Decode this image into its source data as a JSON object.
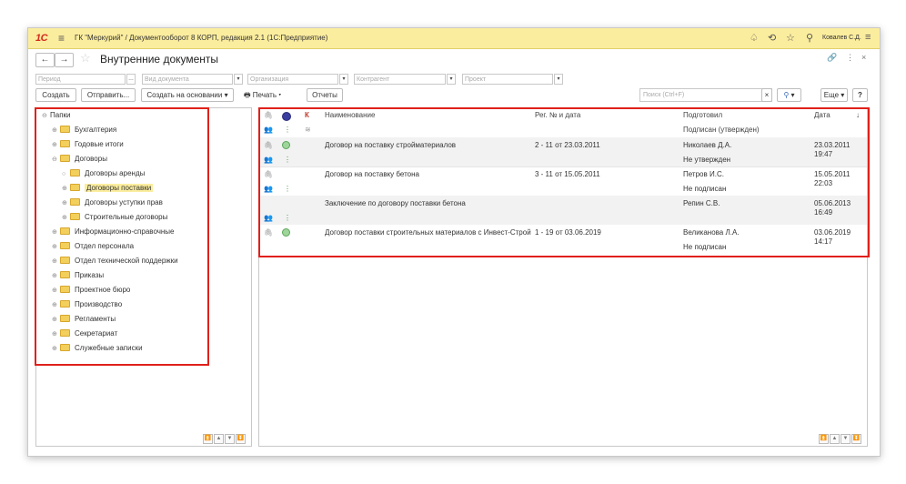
{
  "titlebar": {
    "logo": "1С",
    "menu_icon": "hamburger-icon",
    "title": "ГК \"Меркурий\" / Документооборот 8 КОРП, редакция 2.1  (1С:Предприятие)",
    "user": "Ковалев С.Д."
  },
  "page": {
    "title": "Внутренние документы"
  },
  "filters": {
    "period": "Период",
    "doc_type": "Вид документа",
    "organization": "Организация",
    "counterparty": "Контрагент",
    "project": "Проект"
  },
  "toolbar": {
    "create": "Создать",
    "send": "Отправить...",
    "create_based": "Создать на основании",
    "print": "Печать",
    "reports": "Отчеты",
    "search_placeholder": "Поиск (Ctrl+F)",
    "more": "Еще",
    "help": "?"
  },
  "tree": {
    "root": "Папки",
    "items": [
      {
        "label": "Бухгалтерия"
      },
      {
        "label": "Годовые итоги"
      },
      {
        "label": "Договоры"
      },
      {
        "label": "Договоры аренды"
      },
      {
        "label": "Договоры поставки"
      },
      {
        "label": "Договоры уступки прав"
      },
      {
        "label": "Строительные договоры"
      },
      {
        "label": "Информационно-справочные"
      },
      {
        "label": "Отдел персонала"
      },
      {
        "label": "Отдел технической поддержки"
      },
      {
        "label": "Приказы"
      },
      {
        "label": "Проектное бюро"
      },
      {
        "label": "Производство"
      },
      {
        "label": "Регламенты"
      },
      {
        "label": "Секретариат"
      },
      {
        "label": "Служебные записки"
      }
    ]
  },
  "table": {
    "headers": {
      "k": "К",
      "name": "Наименование",
      "reg": "Рег. № и дата",
      "prepared": "Подготовил",
      "signed": "Подписан (утвержден)",
      "date": "Дата",
      "sort": "↓"
    },
    "rows": [
      {
        "name": "Договор на поставку стройматериалов",
        "reg": "2 - 11 от 23.03.2011",
        "prepared": "Николаев Д.А.",
        "signed": "Не утвержден",
        "date": "23.03.2011",
        "time": "19:47"
      },
      {
        "name": "Договор на поставку бетона",
        "reg": "3 - 11 от 15.05.2011",
        "prepared": "Петров И.С.",
        "signed": "Не подписан",
        "date": "15.05.2011",
        "time": "22:03"
      },
      {
        "name": "Заключение по договору поставки бетона",
        "reg": "",
        "prepared": "Репин С.В.",
        "signed": "",
        "date": "05.06.2013",
        "time": "16:49"
      },
      {
        "name": "Договор поставки строительных материалов с Инвест-Строй",
        "reg": "1 - 19 от 03.06.2019",
        "prepared": "Великанова Л.А.",
        "signed": "Не подписан",
        "date": "03.06.2019",
        "time": "14:17"
      }
    ]
  },
  "colors": {
    "titlebar": "#fbed9e",
    "highlight": "#e0201a",
    "selected": "#fbed9e"
  }
}
